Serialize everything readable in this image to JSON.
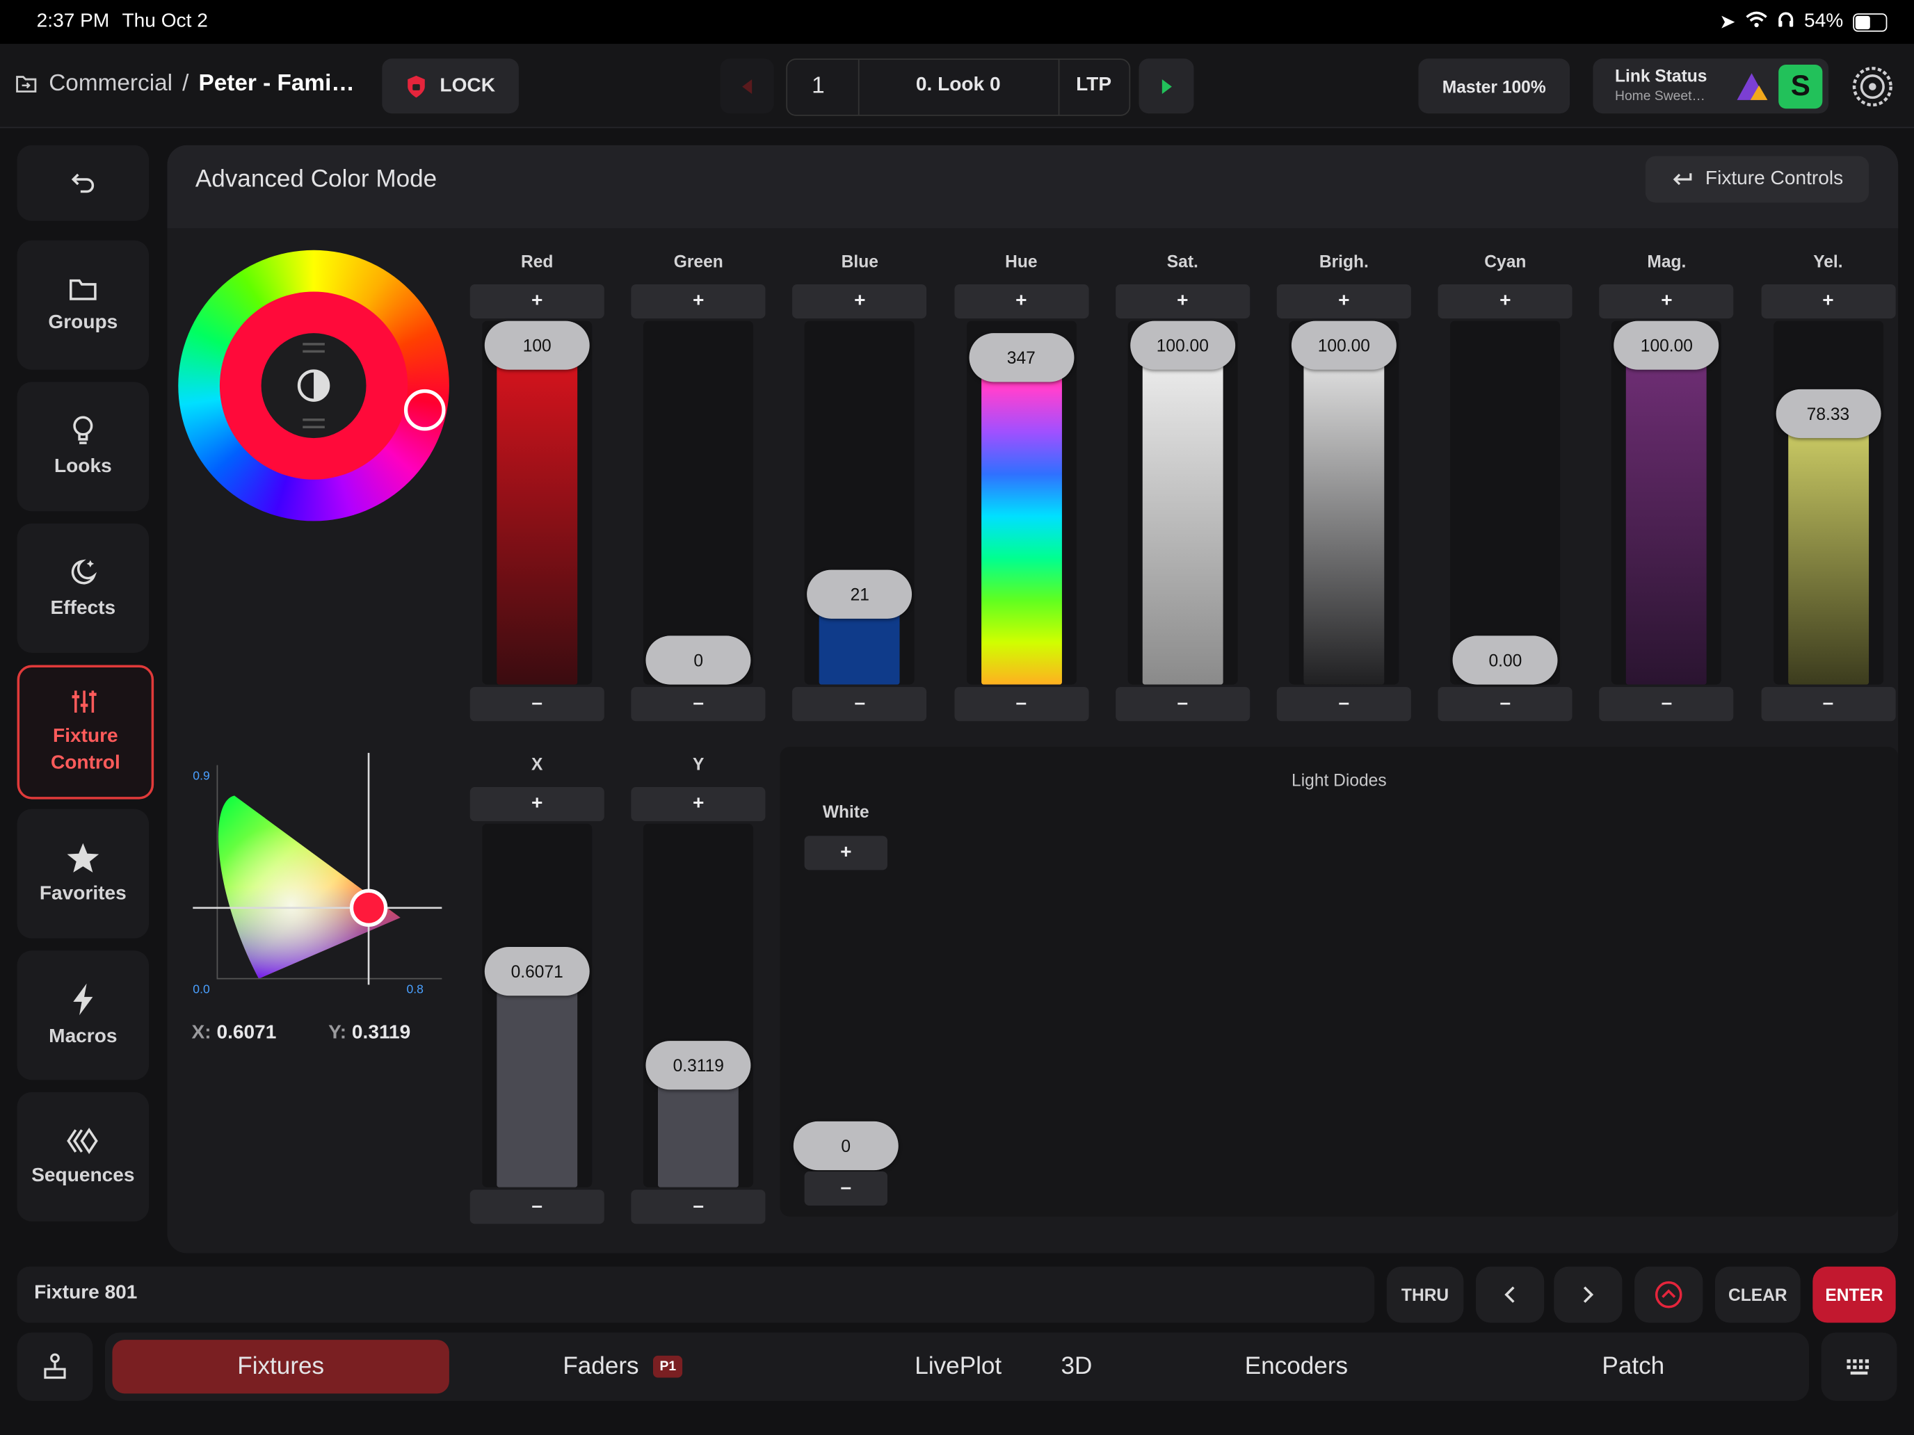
{
  "status": {
    "time": "2:37 PM",
    "date": "Thu Oct 2",
    "battery": "54%",
    "battery_level": 0.54
  },
  "header": {
    "breadcrumb_parent": "Commercial",
    "breadcrumb_sep": "/",
    "breadcrumb_current": "Peter - Fami…",
    "lock_label": "LOCK",
    "cue_number": "1",
    "look_name": "0. Look 0",
    "mode": "LTP",
    "master_label": "Master 100%",
    "link_title": "Link Status",
    "link_sub": "Home Sweet…",
    "link_badge": "S"
  },
  "sidebar": [
    {
      "label": "Groups",
      "icon": "folder-icon"
    },
    {
      "label": "Looks",
      "icon": "lightbulb-icon"
    },
    {
      "label": "Effects",
      "icon": "moon-stars-icon"
    },
    {
      "label": "Fixture\nControl",
      "icon": "sliders-icon"
    },
    {
      "label": "Favorites",
      "icon": "star-icon"
    },
    {
      "label": "Macros",
      "icon": "bolt-icon"
    },
    {
      "label": "Sequences",
      "icon": "sequences-icon"
    }
  ],
  "panel": {
    "title": "Advanced Color Mode",
    "back_label": "Fixture Controls"
  },
  "faders": [
    {
      "label": "Red",
      "value": "100",
      "level": 1.0
    },
    {
      "label": "Green",
      "value": "0",
      "level": 0.0
    },
    {
      "label": "Blue",
      "value": "21",
      "level": 0.21
    },
    {
      "label": "Hue",
      "value": "347",
      "level": 0.96
    },
    {
      "label": "Sat.",
      "value": "100.00",
      "level": 1.0
    },
    {
      "label": "Brigh.",
      "value": "100.00",
      "level": 1.0
    },
    {
      "label": "Cyan",
      "value": "0.00",
      "level": 0.0
    },
    {
      "label": "Mag.",
      "value": "100.00",
      "level": 1.0
    },
    {
      "label": "Yel.",
      "value": "78.33",
      "level": 0.7833
    }
  ],
  "xy_faders": [
    {
      "label": "X",
      "value": "0.6071",
      "level": 0.6071
    },
    {
      "label": "Y",
      "value": "0.3119",
      "level": 0.3119
    }
  ],
  "cie": {
    "ymax": "0.9",
    "xmin": "0.0",
    "xmax": "0.8",
    "x_label": "X:",
    "x_value": "0.6071",
    "y_label": "Y:",
    "y_value": "0.3119"
  },
  "diodes": {
    "title": "Light Diodes",
    "white_label": "White",
    "white_value": "0",
    "plus": "+",
    "minus": "–"
  },
  "controls": {
    "plus": "+",
    "minus": "–"
  },
  "command": {
    "input": "Fixture 801",
    "thru": "THRU",
    "clear": "CLEAR",
    "enter": "ENTER"
  },
  "tabs": {
    "fixtures": "Fixtures",
    "faders": "Faders",
    "faders_badge": "P1",
    "liveplot": "LivePlot",
    "three_d": "3D",
    "encoders": "Encoders",
    "patch": "Patch"
  },
  "colors": {
    "accent": "#e5253c",
    "active_tab": "#7a1f22",
    "link_green": "#22c15a"
  }
}
